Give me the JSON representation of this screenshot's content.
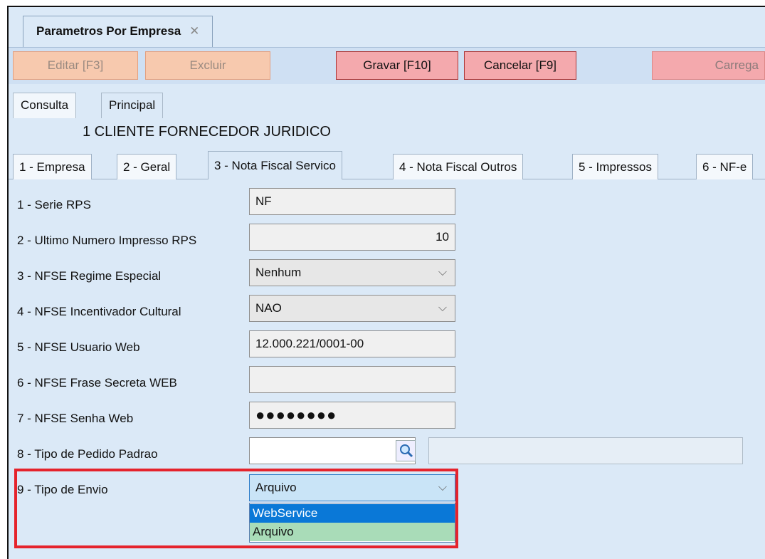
{
  "window_tab": {
    "title": "Parametros Por Empresa",
    "close": "✕"
  },
  "toolbar": {
    "edit": "Editar [F3]",
    "delete": "Excluir",
    "save": "Gravar [F10]",
    "cancel": "Cancelar [F9]",
    "load": "Carrega"
  },
  "view_tabs": [
    "Consulta",
    "Principal"
  ],
  "company": "1  CLIENTE FORNECEDOR JURIDICO",
  "section_tabs": [
    "1 - Empresa",
    "2 - Geral",
    "3 - Nota Fiscal Servico",
    "4 - Nota Fiscal Outros",
    "5 - Impressos",
    "6 - NF-e"
  ],
  "form": {
    "serie_rps": {
      "label": "1 - Serie RPS",
      "value": "NF"
    },
    "ultimo_numero": {
      "label": "2 - Ultimo Numero Impresso RPS",
      "value": "10"
    },
    "regime_especial": {
      "label": "3 - NFSE Regime Especial",
      "value": "Nenhum"
    },
    "incentivador": {
      "label": "4 - NFSE Incentivador Cultural",
      "value": "NAO"
    },
    "usuario_web": {
      "label": "5 - NFSE Usuario Web",
      "value": "12.000.221/0001-00"
    },
    "frase_secreta": {
      "label": "6 - NFSE Frase Secreta WEB",
      "value": ""
    },
    "senha_web": {
      "label": "7 - NFSE Senha Web",
      "value": "●●●●●●●●"
    },
    "tipo_pedido": {
      "label": "8 - Tipo de Pedido Padrao",
      "value": "",
      "description": ""
    },
    "tipo_envio": {
      "label": "9 - Tipo de Envio",
      "value": "Arquivo",
      "options": [
        "WebService",
        "Arquivo"
      ]
    }
  },
  "colors": {
    "highlight": "#e5232c",
    "dropdown_selected": "#0a78d7",
    "dropdown_hover": "#a9dcb8"
  }
}
